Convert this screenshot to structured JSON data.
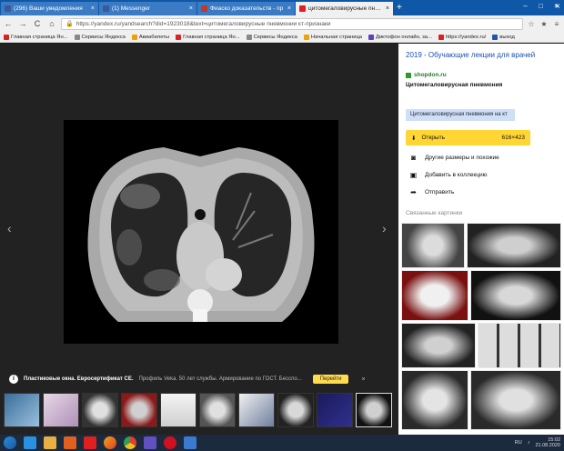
{
  "tabs": [
    {
      "label": "(296) Ваши уведомления",
      "color": "#3b5998"
    },
    {
      "label": "(1) Messenger",
      "color": "#3b5998"
    },
    {
      "label": "Фиаско доказательств - пр",
      "color": "#c0392b"
    },
    {
      "label": "цитомегаловирусные пневмон",
      "color": "#e02020"
    }
  ],
  "new_tab": "+",
  "window_controls": [
    "–",
    "□",
    "×"
  ],
  "url": "https://yandex.ru/yandsearch?did=1923018&text=цитомегаловирусные пневмонии кт-признаки",
  "nav": {
    "back": "←",
    "forward": "→",
    "reload": "C",
    "home": "⌂"
  },
  "bookmarks": [
    {
      "label": "Главная страница Ян...",
      "color": "#e02020"
    },
    {
      "label": "Сервисы Яндекса",
      "color": "#888888"
    },
    {
      "label": "Авиабилеты",
      "color": "#f0a000"
    },
    {
      "label": "Главная страница Ян...",
      "color": "#e02020"
    },
    {
      "label": "Сервисы Яндекса",
      "color": "#888888"
    },
    {
      "label": "Начальная страница",
      "color": "#f0a000"
    },
    {
      "label": "Диктофон онлайн, за...",
      "color": "#6040c0"
    },
    {
      "label": "https://yandex.ru/",
      "color": "#e02020"
    },
    {
      "label": "выход",
      "color": "#2255aa"
    }
  ],
  "viewer": {
    "prev": "‹",
    "next": "›",
    "ad": {
      "title": "Пластиковые окна. Евросертификат CE.",
      "text": "Профиль Veka. 50 лет службы. Армирование по ГОСТ. Бесспо...",
      "button": "Перейти",
      "close": "×"
    }
  },
  "side": {
    "title": "2019 - Обучающие лекции для врачей",
    "domain": "shopdon.ru",
    "subtitle": "Цитомегаловирусная пневмония",
    "chip": "Цитомегаловирусная пневмония на кт",
    "open_label": "Открыть",
    "open_size": "616×423",
    "actions": [
      {
        "icon": "camera-icon",
        "glyph": "◙",
        "label": "Другие размеры и похожие"
      },
      {
        "icon": "collection-icon",
        "glyph": "▣",
        "label": "Добавить в коллекцию"
      },
      {
        "icon": "share-icon",
        "glyph": "➦",
        "label": "Отправить"
      }
    ],
    "related_title": "Связанные картинки",
    "close": "×"
  },
  "taskbar": {
    "lang": "RU",
    "time": "15:02",
    "date": "21.08.2020"
  }
}
